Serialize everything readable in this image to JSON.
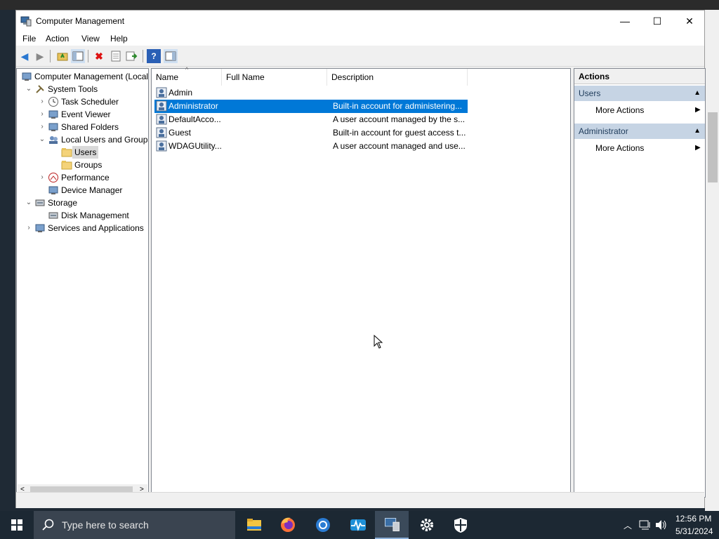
{
  "window": {
    "title": "Computer Management",
    "controls": {
      "minimize": "—",
      "maximize": "☐",
      "close": "✕"
    }
  },
  "menu": [
    "File",
    "Action",
    "View",
    "Help"
  ],
  "tree": [
    {
      "label": "Computer Management (Local",
      "icon": "computer-management-icon",
      "expand": ""
    },
    {
      "label": "System Tools",
      "icon": "tools-icon",
      "expand": "v"
    },
    {
      "label": "Task Scheduler",
      "icon": "clock-icon",
      "expand": ">"
    },
    {
      "label": "Event Viewer",
      "icon": "event-viewer-icon",
      "expand": ">"
    },
    {
      "label": "Shared Folders",
      "icon": "shared-folder-icon",
      "expand": ">"
    },
    {
      "label": "Local Users and Groups",
      "icon": "users-groups-icon",
      "expand": "v"
    },
    {
      "label": "Users",
      "icon": "folder-icon",
      "expand": ""
    },
    {
      "label": "Groups",
      "icon": "folder-icon",
      "expand": ""
    },
    {
      "label": "Performance",
      "icon": "performance-icon",
      "expand": ">"
    },
    {
      "label": "Device Manager",
      "icon": "device-manager-icon",
      "expand": ""
    },
    {
      "label": "Storage",
      "icon": "storage-icon",
      "expand": "v"
    },
    {
      "label": "Disk Management",
      "icon": "disk-icon",
      "expand": ""
    },
    {
      "label": "Services and Applications",
      "icon": "services-icon",
      "expand": ">"
    }
  ],
  "list": {
    "columns": [
      "Name",
      "Full Name",
      "Description"
    ],
    "rows": [
      {
        "name": "Admin",
        "full_name": "",
        "description": ""
      },
      {
        "name": "Administrator",
        "full_name": "",
        "description": "Built-in account for administering..."
      },
      {
        "name": "DefaultAcco...",
        "full_name": "",
        "description": "A user account managed by the s..."
      },
      {
        "name": "Guest",
        "full_name": "",
        "description": "Built-in account for guest access t..."
      },
      {
        "name": "WDAGUtility...",
        "full_name": "",
        "description": "A user account managed and use..."
      }
    ]
  },
  "actions": {
    "header": "Actions",
    "sections": [
      {
        "title": "Users",
        "item": "More Actions"
      },
      {
        "title": "Administrator",
        "item": "More Actions"
      }
    ]
  },
  "taskbar": {
    "search_placeholder": "Type here to search",
    "time": "12:56 PM",
    "date": "5/31/2024"
  },
  "colors": {
    "selection": "#0078d7",
    "taskbar": "#1c2833",
    "action_section": "#c6d4e4"
  }
}
